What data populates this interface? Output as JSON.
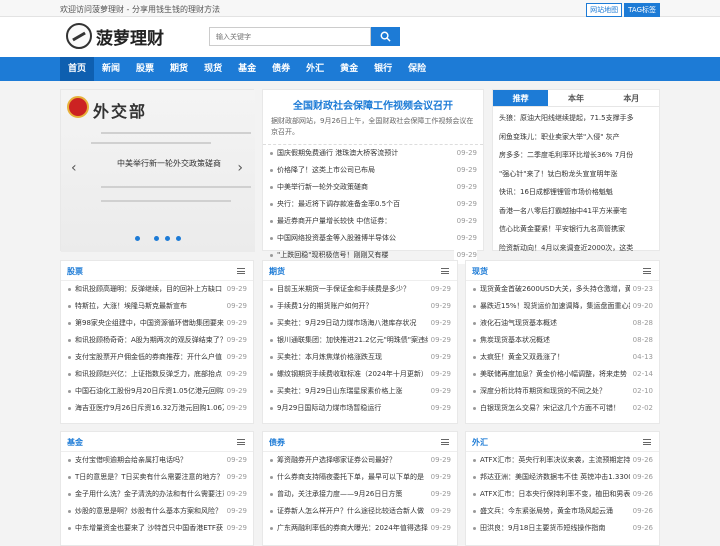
{
  "topbar": {
    "welcome": "欢迎访问菠萝理财 - 分享用钱生钱的理财方法",
    "sitemap": "网站地图",
    "tags": "TAG标签"
  },
  "logo": {
    "name": "菠萝理财"
  },
  "search": {
    "placeholder": "输入关键字",
    "icon": "search-icon"
  },
  "nav": [
    "首页",
    "新闻",
    "股票",
    "期货",
    "现货",
    "基金",
    "债券",
    "外汇",
    "黄金",
    "银行",
    "保险"
  ],
  "banner": {
    "title": "外交部",
    "caption": "中美举行新一轮外交政策磋商"
  },
  "featured": {
    "title": "全国财政社会保障工作视频会议召开",
    "desc": "据财政部网站，9月26日上午，全国财政社会保障工作视频会议在京召开。",
    "items": [
      {
        "t": "国庆假期免费通行 港珠澳大桥客流预计",
        "d": "09-29"
      },
      {
        "t": "价格降了！这类上市公司已布局",
        "d": "09-29"
      },
      {
        "t": "中美举行新一轮外交政策磋商",
        "d": "09-29"
      },
      {
        "t": "央行：最近将下调存款准备金率0.5个百",
        "d": "09-29"
      },
      {
        "t": "最近券商开户量增长较快 中信证券：",
        "d": "09-29"
      },
      {
        "t": "中国网络投资基金等入股雅博半导体公",
        "d": "09-29"
      },
      {
        "t": "\"上跌回稳\"现积极信号！刚刚又有楼",
        "d": "09-29"
      }
    ]
  },
  "rank": {
    "tabs": [
      "推荐",
      "本年",
      "本月"
    ],
    "items": [
      "头狼：原油大阳线继续提起，71.5支撑手多",
      "闲鱼变珠儿：职业卖家大举\"入侵\" 灰产",
      "房多多：二季度毛利率环比增长36% 7月份",
      "\"强心针\"来了！钛白粉龙头宣宣明年涨",
      "快讯：16日成都锂锂管市场价格魁魁",
      "香港一名八零后打霸越抽中41平方米豪宅",
      "信心比黄金要紧！平安银行九名高管携家",
      "险资新动向！4月以来调查近2000次，这类"
    ]
  },
  "boxes": [
    {
      "title": "股票",
      "items": [
        {
          "t": "和讯投顾高珊明：反弹继续，目的回补上方缺口",
          "d": "09-29"
        },
        {
          "t": "特斯拉，大涨！埃隆马斯克最新宣布",
          "d": "09-29"
        },
        {
          "t": "第98家央企组建中，中国资源循环借助集团要来了",
          "d": "09-29"
        },
        {
          "t": "和讯投顾杨奇奇：A股为期两次的观反弹结束了？",
          "d": "09-29"
        },
        {
          "t": "支付宝股票开户佣金低的券商推荐：开什么户值",
          "d": "09-29"
        },
        {
          "t": "和讯投顾赵兴亿：上证指数反弹乏力，底部抬点",
          "d": "09-29"
        },
        {
          "t": "中国石油化工股份9月20日斥资1.05亿港元回购2323",
          "d": "09-29"
        },
        {
          "t": "海吉亚医疗9月26日斥资16.32万港元回购1.06万股",
          "d": "09-29"
        }
      ]
    },
    {
      "title": "期货",
      "items": [
        {
          "t": "目前玉米期货一手保证金和手续费是多少？",
          "d": "09-29"
        },
        {
          "t": "手续费1分的期货账户如何开？",
          "d": "09-29"
        },
        {
          "t": "买卖社：9月29日动力煤市场海八港库存状况",
          "d": "09-29"
        },
        {
          "t": "银川通联集团：加快推进21.2亿元\"明珠债\"案违约",
          "d": "09-29"
        },
        {
          "t": "买卖社：本月炼焦煤价格涨跌互现",
          "d": "09-29"
        },
        {
          "t": "螺纹钢期货手续费收取标准（2024年十月更新）",
          "d": "09-29"
        },
        {
          "t": "买卖社：9月29日山东瑞星尿素价格上涨",
          "d": "09-29"
        },
        {
          "t": "9月29日国际动力煤市场暂稳运行",
          "d": "09-29"
        }
      ]
    },
    {
      "title": "现货",
      "items": [
        {
          "t": "现货黄金首破2600USD大关，多头持仓激增，黄金",
          "d": "09-23"
        },
        {
          "t": "暴跌近15%！现货运价加速调降，集运盘面重心持续",
          "d": "09-20"
        },
        {
          "t": "液化石油气现货基本概述",
          "d": "08-28"
        },
        {
          "t": "焦炭现货基本状况概述",
          "d": "08-28"
        },
        {
          "t": "太疯狂！黄金又双叒涨了！",
          "d": "04-13"
        },
        {
          "t": "美联储再度加息？黄金价格小幅调整，将来走势",
          "d": "02-14"
        },
        {
          "t": "深度分析比特币期货和现货的不同之处？",
          "d": "02-10"
        },
        {
          "t": "白银现货怎么交易？宋记这几个方面不可错！",
          "d": "02-02"
        }
      ]
    },
    {
      "title": "基金",
      "items": [
        {
          "t": "支付宝借呗逾期会给亲属打电话吗？",
          "d": "09-29"
        },
        {
          "t": "T日的意思是？T日买卖有什么需要注意的地方？",
          "d": "09-29"
        },
        {
          "t": "金子用什么洗？金子清洗的办法和有什么需要注意",
          "d": "09-29"
        },
        {
          "t": "炒股的意思是啊？炒股有什么基本方案和风险？",
          "d": "09-29"
        },
        {
          "t": "中东增量资金也要来了 沙特首只中国香港ETF获",
          "d": "09-29"
        }
      ]
    },
    {
      "title": "债券",
      "items": [
        {
          "t": "筹资融券开户选择哪家证券公司最好？",
          "d": "09-29"
        },
        {
          "t": "什么券商支持隔夜委托下单，最早可以下单的是",
          "d": "09-29"
        },
        {
          "t": "曾动，关注承接力度——9月26日日方策",
          "d": "09-29"
        },
        {
          "t": "证券新人怎么样开户？什么途径比较适合新人做",
          "d": "09-29"
        },
        {
          "t": "广东两融利率低的券商大曝光：2024年值得选择的",
          "d": "09-29"
        }
      ]
    },
    {
      "title": "外汇",
      "items": [
        {
          "t": "ATFX汇市：英央行利率决议来袭，主流预期定持",
          "d": "09-26"
        },
        {
          "t": "邦达亚洲：美国经济数据韦不佳 英镑冲击1.3300",
          "d": "09-26"
        },
        {
          "t": "ATFX汇市：日本央行保持利率不变，植田和男表",
          "d": "09-26"
        },
        {
          "t": "盛文兵：今东紧张局势，黄金市场风起云涌",
          "d": "09-26"
        },
        {
          "t": "田洪良：9月18日主要货币短线操作指南",
          "d": "09-26"
        }
      ]
    }
  ]
}
